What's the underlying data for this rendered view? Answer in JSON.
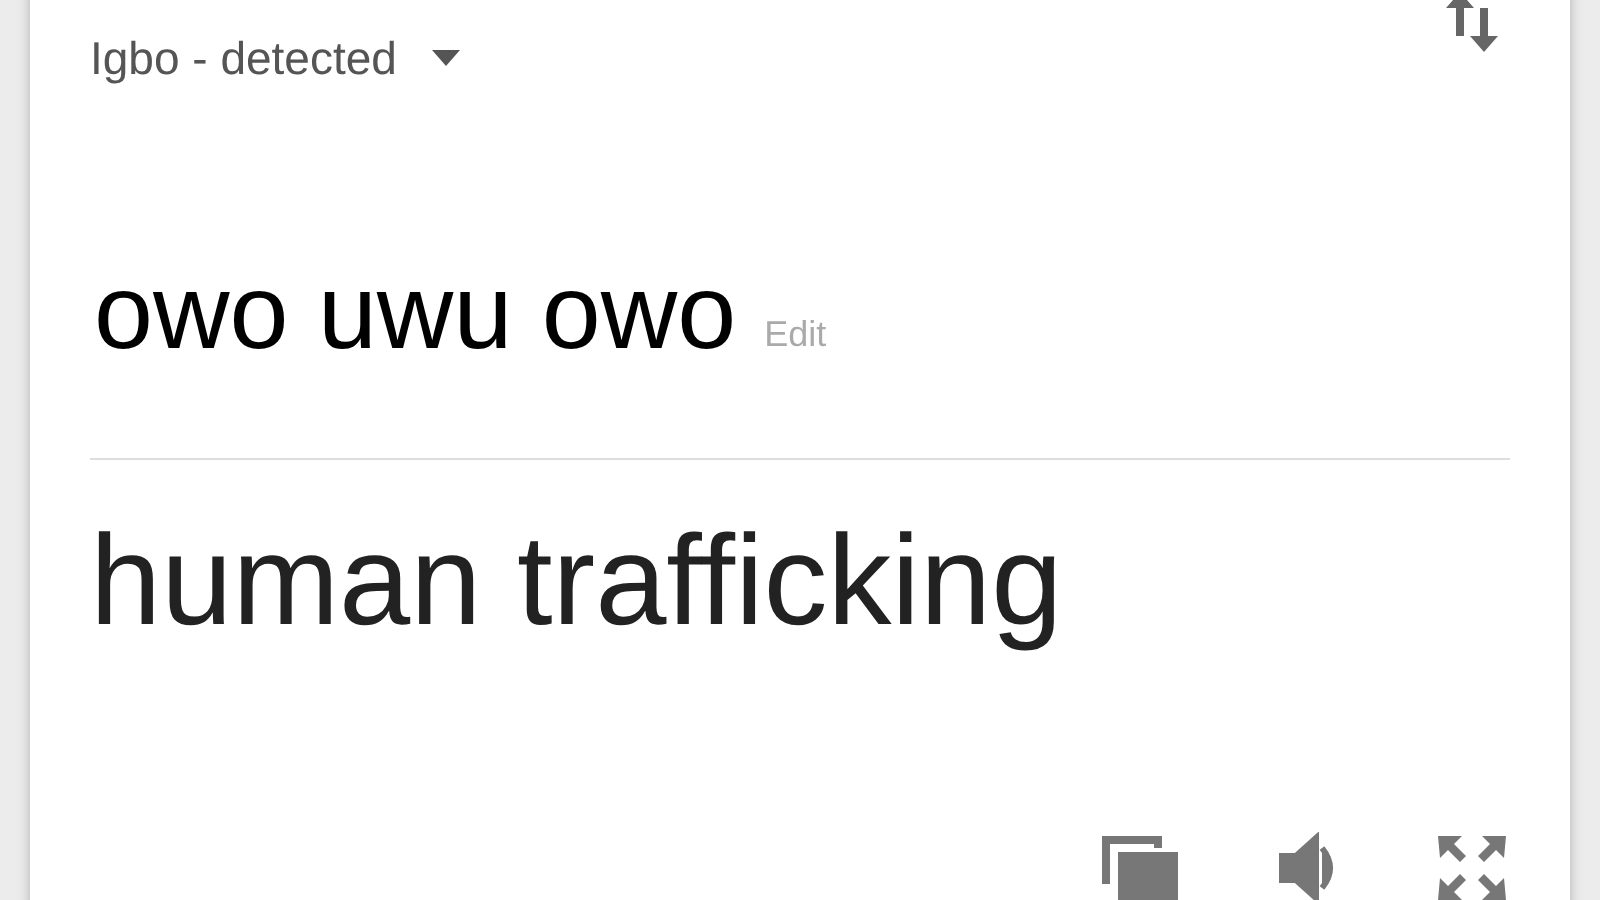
{
  "source_language": {
    "label": "Igbo - detected"
  },
  "source_text": {
    "value": "owo uwu owo",
    "edit_link": "Edit"
  },
  "translation": {
    "value": "human trafficking"
  }
}
